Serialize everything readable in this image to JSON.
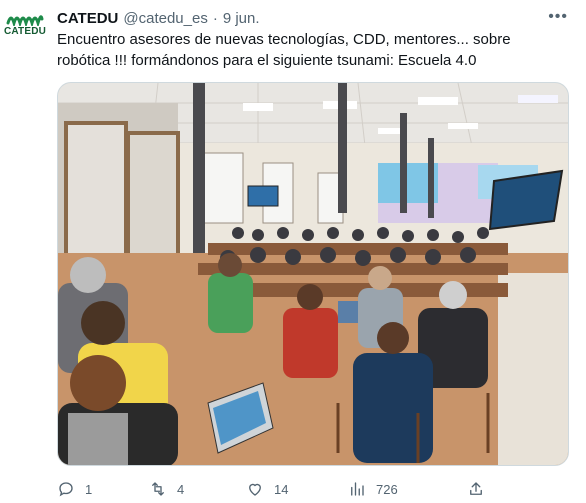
{
  "account": {
    "avatar_label": "CATEDU",
    "display_name": "CATEDU",
    "handle": "@catedu_es",
    "separator": "·",
    "date": "9 jun."
  },
  "tweet": {
    "text": "Encuentro asesores de nuevas tecnologías, CDD, mentores... sobre robótica !!! formándonos para el siguiente tsunami: Escuela 4.0"
  },
  "media": {
    "description_icon": "photo-conference-room"
  },
  "actions": {
    "reply_count": "1",
    "retweet_count": "4",
    "like_count": "14",
    "views_count": "726"
  },
  "colors": {
    "brand_green": "#1e8b4a",
    "text_secondary": "#536471"
  }
}
